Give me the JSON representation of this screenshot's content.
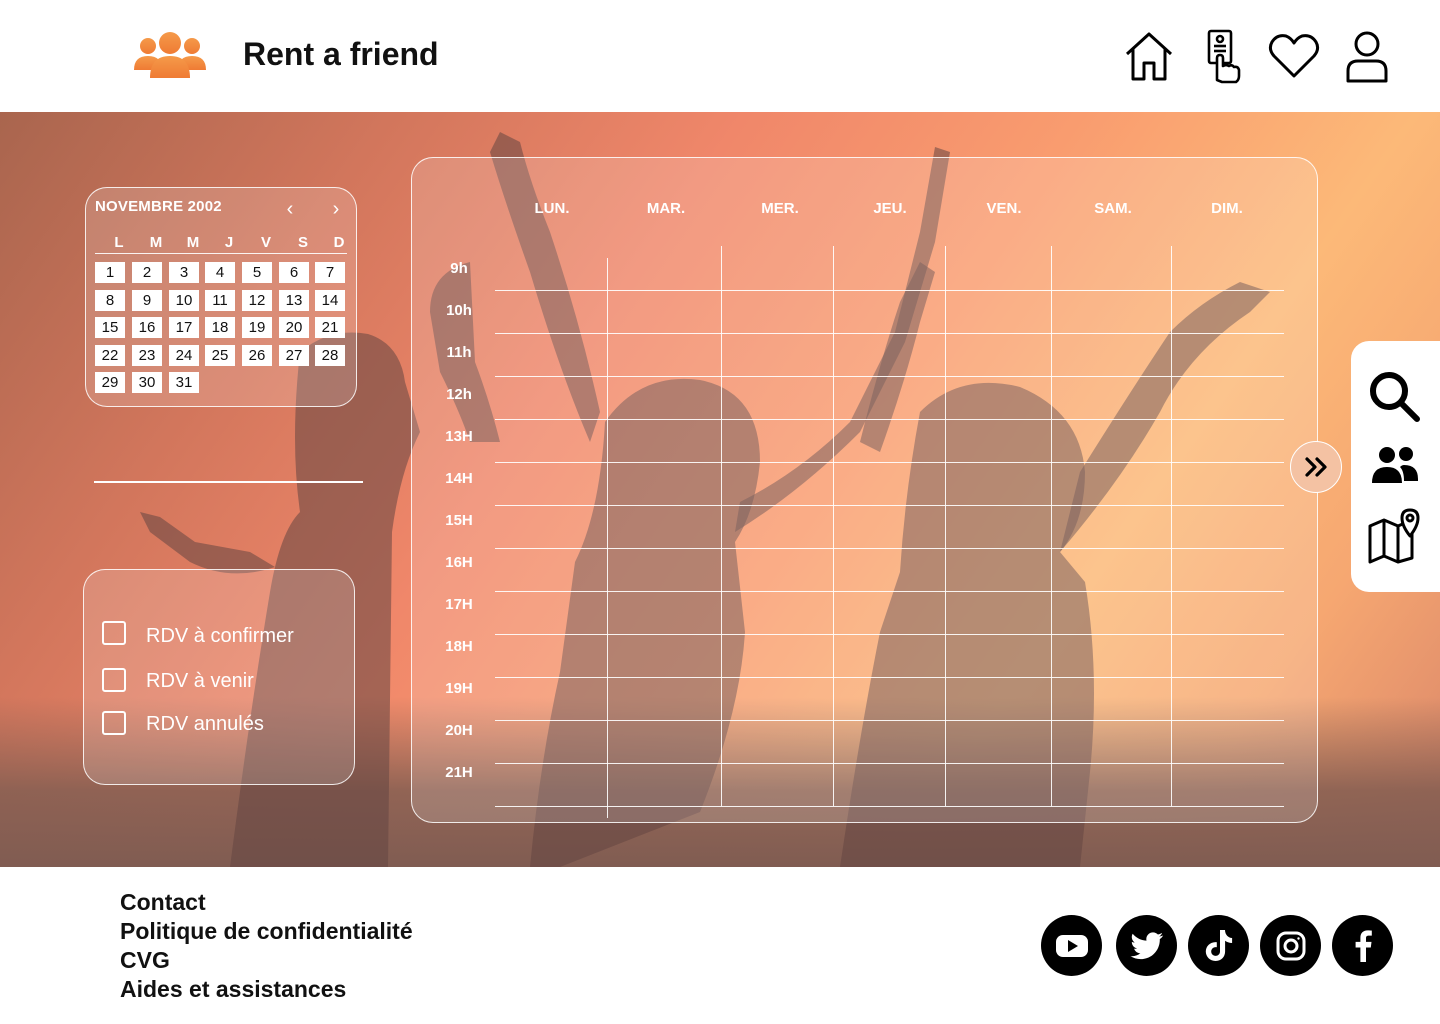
{
  "header": {
    "brand": "Rent a friend",
    "icons": [
      "people-group-icon",
      "home-icon",
      "tap-card-icon",
      "heart-icon",
      "user-icon"
    ]
  },
  "colors": {
    "brand_orange": "#f28a3a",
    "black": "#000000",
    "white": "#ffffff"
  },
  "mini_calendar": {
    "title": "NOVEMBRE 2002",
    "prev": "‹",
    "next": "›",
    "weekdays": [
      "L",
      "M",
      "M",
      "J",
      "V",
      "S",
      "D"
    ],
    "days": [
      "1",
      "2",
      "3",
      "4",
      "5",
      "6",
      "7",
      "8",
      "9",
      "10",
      "11",
      "12",
      "13",
      "14",
      "15",
      "16",
      "17",
      "18",
      "19",
      "20",
      "21",
      "22",
      "23",
      "24",
      "25",
      "26",
      "27",
      "28",
      "29",
      "30",
      "31"
    ]
  },
  "filters": {
    "items": [
      {
        "label": "RDV à confirmer",
        "checked": false
      },
      {
        "label": "RDV à venir",
        "checked": false
      },
      {
        "label": "RDV annulés",
        "checked": false
      }
    ]
  },
  "schedule": {
    "days": [
      "LUN.",
      "MAR.",
      "MER.",
      "JEU.",
      "VEN.",
      "SAM.",
      "DIM."
    ],
    "hours": [
      "9h",
      "10h",
      "11h",
      "12h",
      "13H",
      "14H",
      "15H",
      "16H",
      "17H",
      "18H",
      "19H",
      "20H",
      "21H"
    ]
  },
  "side_panel": {
    "icons": [
      "search-icon",
      "friends-icon",
      "map-pin-icon"
    ]
  },
  "footer": {
    "links": [
      "Contact",
      "Politique de confidentialité",
      "CVG",
      "Aides et assistances"
    ],
    "social": [
      "youtube-icon",
      "twitter-icon",
      "tiktok-icon",
      "instagram-icon",
      "facebook-icon"
    ]
  }
}
